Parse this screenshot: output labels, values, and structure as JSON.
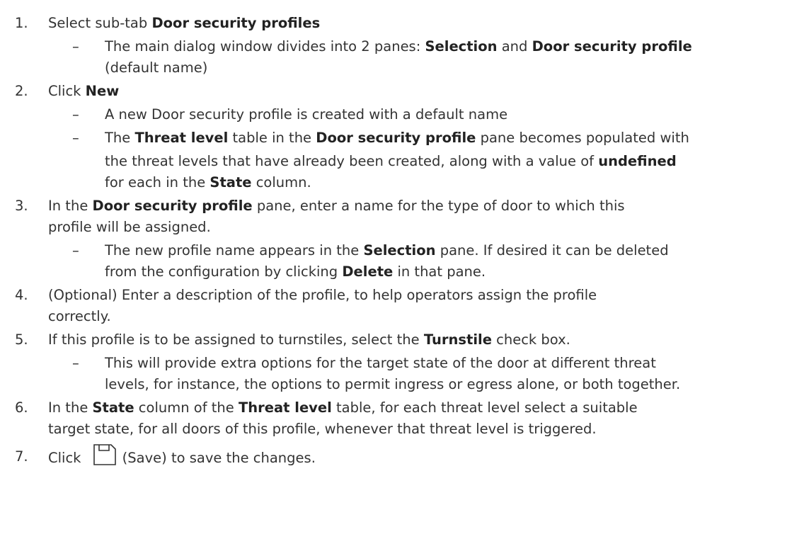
{
  "steps": [
    {
      "num": "1.",
      "parts": [
        {
          "t": "Select sub-tab "
        },
        {
          "t": "Door security profiles",
          "b": true
        }
      ],
      "subs": [
        [
          [
            {
              "t": "The main dialog window divides into 2 panes: "
            },
            {
              "t": "Selection",
              "b": true
            },
            {
              "t": " and "
            },
            {
              "t": "Door security profile",
              "b": true
            }
          ],
          [
            {
              "t": "(default name)"
            }
          ]
        ]
      ]
    },
    {
      "num": "2.",
      "parts": [
        {
          "t": "Click "
        },
        {
          "t": "New",
          "b": true
        }
      ],
      "subs": [
        [
          [
            {
              "t": "A new Door security profile is created with a default name"
            }
          ]
        ],
        [
          [
            {
              "t": "The "
            },
            {
              "t": "Threat level",
              "b": true
            },
            {
              "t": " table in the "
            },
            {
              "t": "Door security profile",
              "b": true
            },
            {
              "t": " pane becomes populated with"
            }
          ],
          [
            {
              "t": "the threat levels that have already been created, along with a value of "
            },
            {
              "t": "undefined",
              "b": true
            }
          ],
          [
            {
              "t": "for each in the "
            },
            {
              "t": "State",
              "b": true
            },
            {
              "t": " column."
            }
          ]
        ]
      ]
    },
    {
      "num": "3.",
      "parts": [
        {
          "t": "In the "
        },
        {
          "t": "Door security profile",
          "b": true
        },
        {
          "t": " pane, enter a name for the type of door to which this"
        }
      ],
      "cont": [
        [
          {
            "t": "profile will be assigned."
          }
        ]
      ],
      "subs": [
        [
          [
            {
              "t": "The new profile name appears in the "
            },
            {
              "t": "Selection",
              "b": true
            },
            {
              "t": " pane. If desired it can be deleted"
            }
          ],
          [
            {
              "t": "from the configuration by clicking "
            },
            {
              "t": "Delete",
              "b": true
            },
            {
              "t": " in that pane."
            }
          ]
        ]
      ]
    },
    {
      "num": "4.",
      "parts": [
        {
          "t": "(Optional) Enter a description of the profile, to help operators assign the profile"
        }
      ],
      "cont": [
        [
          {
            "t": "correctly."
          }
        ]
      ]
    },
    {
      "num": "5.",
      "parts": [
        {
          "t": "If this profile is to be assigned to turnstiles, select the "
        },
        {
          "t": "Turnstile",
          "b": true
        },
        {
          "t": " check box."
        }
      ],
      "subs": [
        [
          [
            {
              "t": "This will provide extra options for the target state of the door at different threat"
            }
          ],
          [
            {
              "t": "levels, for instance, the options to permit ingress or egress alone, or both together."
            }
          ]
        ]
      ]
    },
    {
      "num": "6.",
      "parts": [
        {
          "t": "In the "
        },
        {
          "t": "State",
          "b": true
        },
        {
          "t": " column of the "
        },
        {
          "t": "Threat level",
          "b": true
        },
        {
          "t": " table, for each threat level select a suitable"
        }
      ],
      "cont": [
        [
          {
            "t": "target state, for all doors of this profile, whenever that threat level is triggered."
          }
        ]
      ]
    },
    {
      "num": "7.",
      "parts": [
        {
          "t": "Click "
        },
        {
          "icon": "save-icon"
        },
        {
          "t": "(Save) to save the changes."
        }
      ]
    }
  ],
  "dash": "–"
}
